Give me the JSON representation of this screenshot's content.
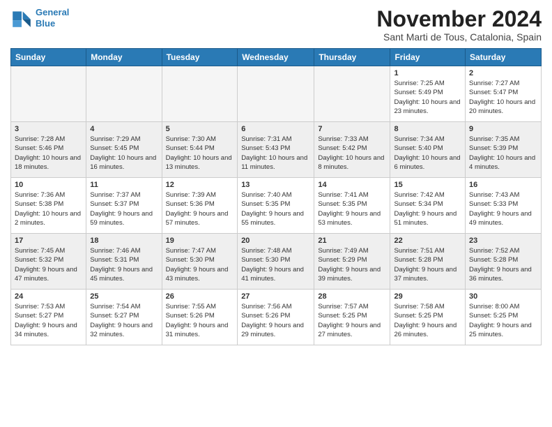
{
  "header": {
    "logo_line1": "General",
    "logo_line2": "Blue",
    "month": "November 2024",
    "location": "Sant Marti de Tous, Catalonia, Spain"
  },
  "days_of_week": [
    "Sunday",
    "Monday",
    "Tuesday",
    "Wednesday",
    "Thursday",
    "Friday",
    "Saturday"
  ],
  "weeks": [
    [
      {
        "day": "",
        "info": ""
      },
      {
        "day": "",
        "info": ""
      },
      {
        "day": "",
        "info": ""
      },
      {
        "day": "",
        "info": ""
      },
      {
        "day": "",
        "info": ""
      },
      {
        "day": "1",
        "info": "Sunrise: 7:25 AM\nSunset: 5:49 PM\nDaylight: 10 hours and 23 minutes."
      },
      {
        "day": "2",
        "info": "Sunrise: 7:27 AM\nSunset: 5:47 PM\nDaylight: 10 hours and 20 minutes."
      }
    ],
    [
      {
        "day": "3",
        "info": "Sunrise: 7:28 AM\nSunset: 5:46 PM\nDaylight: 10 hours and 18 minutes."
      },
      {
        "day": "4",
        "info": "Sunrise: 7:29 AM\nSunset: 5:45 PM\nDaylight: 10 hours and 16 minutes."
      },
      {
        "day": "5",
        "info": "Sunrise: 7:30 AM\nSunset: 5:44 PM\nDaylight: 10 hours and 13 minutes."
      },
      {
        "day": "6",
        "info": "Sunrise: 7:31 AM\nSunset: 5:43 PM\nDaylight: 10 hours and 11 minutes."
      },
      {
        "day": "7",
        "info": "Sunrise: 7:33 AM\nSunset: 5:42 PM\nDaylight: 10 hours and 8 minutes."
      },
      {
        "day": "8",
        "info": "Sunrise: 7:34 AM\nSunset: 5:40 PM\nDaylight: 10 hours and 6 minutes."
      },
      {
        "day": "9",
        "info": "Sunrise: 7:35 AM\nSunset: 5:39 PM\nDaylight: 10 hours and 4 minutes."
      }
    ],
    [
      {
        "day": "10",
        "info": "Sunrise: 7:36 AM\nSunset: 5:38 PM\nDaylight: 10 hours and 2 minutes."
      },
      {
        "day": "11",
        "info": "Sunrise: 7:37 AM\nSunset: 5:37 PM\nDaylight: 9 hours and 59 minutes."
      },
      {
        "day": "12",
        "info": "Sunrise: 7:39 AM\nSunset: 5:36 PM\nDaylight: 9 hours and 57 minutes."
      },
      {
        "day": "13",
        "info": "Sunrise: 7:40 AM\nSunset: 5:35 PM\nDaylight: 9 hours and 55 minutes."
      },
      {
        "day": "14",
        "info": "Sunrise: 7:41 AM\nSunset: 5:35 PM\nDaylight: 9 hours and 53 minutes."
      },
      {
        "day": "15",
        "info": "Sunrise: 7:42 AM\nSunset: 5:34 PM\nDaylight: 9 hours and 51 minutes."
      },
      {
        "day": "16",
        "info": "Sunrise: 7:43 AM\nSunset: 5:33 PM\nDaylight: 9 hours and 49 minutes."
      }
    ],
    [
      {
        "day": "17",
        "info": "Sunrise: 7:45 AM\nSunset: 5:32 PM\nDaylight: 9 hours and 47 minutes."
      },
      {
        "day": "18",
        "info": "Sunrise: 7:46 AM\nSunset: 5:31 PM\nDaylight: 9 hours and 45 minutes."
      },
      {
        "day": "19",
        "info": "Sunrise: 7:47 AM\nSunset: 5:30 PM\nDaylight: 9 hours and 43 minutes."
      },
      {
        "day": "20",
        "info": "Sunrise: 7:48 AM\nSunset: 5:30 PM\nDaylight: 9 hours and 41 minutes."
      },
      {
        "day": "21",
        "info": "Sunrise: 7:49 AM\nSunset: 5:29 PM\nDaylight: 9 hours and 39 minutes."
      },
      {
        "day": "22",
        "info": "Sunrise: 7:51 AM\nSunset: 5:28 PM\nDaylight: 9 hours and 37 minutes."
      },
      {
        "day": "23",
        "info": "Sunrise: 7:52 AM\nSunset: 5:28 PM\nDaylight: 9 hours and 36 minutes."
      }
    ],
    [
      {
        "day": "24",
        "info": "Sunrise: 7:53 AM\nSunset: 5:27 PM\nDaylight: 9 hours and 34 minutes."
      },
      {
        "day": "25",
        "info": "Sunrise: 7:54 AM\nSunset: 5:27 PM\nDaylight: 9 hours and 32 minutes."
      },
      {
        "day": "26",
        "info": "Sunrise: 7:55 AM\nSunset: 5:26 PM\nDaylight: 9 hours and 31 minutes."
      },
      {
        "day": "27",
        "info": "Sunrise: 7:56 AM\nSunset: 5:26 PM\nDaylight: 9 hours and 29 minutes."
      },
      {
        "day": "28",
        "info": "Sunrise: 7:57 AM\nSunset: 5:25 PM\nDaylight: 9 hours and 27 minutes."
      },
      {
        "day": "29",
        "info": "Sunrise: 7:58 AM\nSunset: 5:25 PM\nDaylight: 9 hours and 26 minutes."
      },
      {
        "day": "30",
        "info": "Sunrise: 8:00 AM\nSunset: 5:25 PM\nDaylight: 9 hours and 25 minutes."
      }
    ]
  ]
}
